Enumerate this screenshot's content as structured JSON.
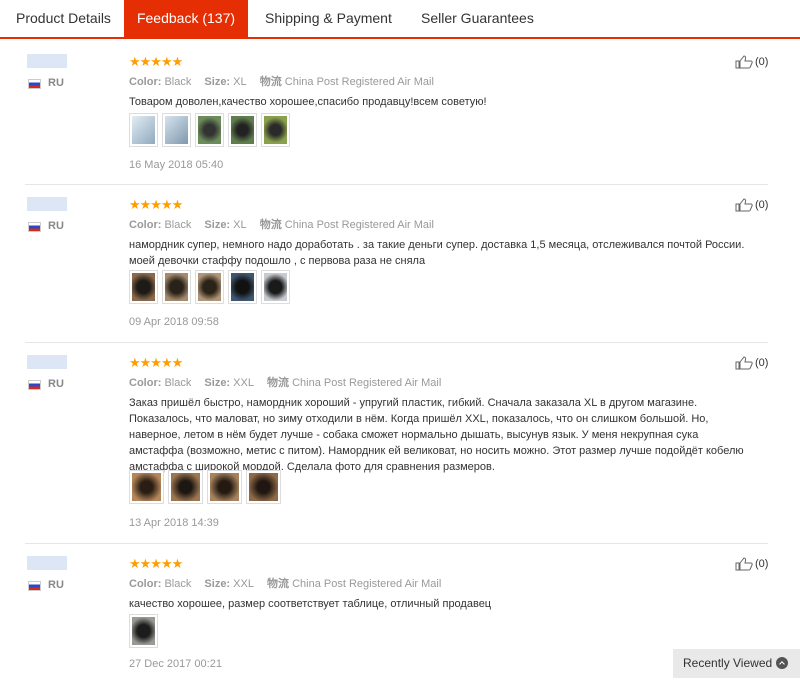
{
  "tabs": [
    "Product Details",
    "Feedback (137)",
    "Shipping & Payment",
    "Seller Guarantees"
  ],
  "labels": {
    "color": "Color:",
    "size": "Size:",
    "shipping": "物流",
    "stars": "★★★★★"
  },
  "reviews": [
    {
      "country": "RU",
      "color": "Black",
      "size": "XL",
      "shipping": "China Post Registered Air Mail",
      "text": "Товаром доволен,качество хорошее,спасибо продавцу!всем советую!",
      "date": "16 May 2018 05:40",
      "likes": "(0)",
      "photo_count": 5,
      "rating": 5
    },
    {
      "country": "RU",
      "color": "Black",
      "size": "XL",
      "shipping": "China Post Registered Air Mail",
      "text": "намордник супер, немного надо доработать . за такие деньги супер. доставка 1,5 месяца, отслеживался почтой России. моей девочки стаффу подошло , с первова раза не сняла",
      "date": "09 Apr 2018 09:58",
      "likes": "(0)",
      "photo_count": 5,
      "rating": 5
    },
    {
      "country": "RU",
      "color": "Black",
      "size": "XXL",
      "shipping": "China Post Registered Air Mail",
      "text": "Заказ пришёл быстро, намордник хороший - упругий пластик, гибкий. Сначала заказала XL в другом магазине. Показалось, что маловат, но зиму отходили в нём. Когда пришёл XXL, показалось, что он слишком большой. Но, наверное, летом в нём будет лучше - собака сможет нормально дышать, высунув язык. У меня некрупная сука амстаффа (возможно, метис с питом). Намордник ей великоват, но носить можно. Этот размер лучше подойдёт кобелю амстаффа с широкой мордой. Сделала фото для сравнения размеров.",
      "date": "13 Apr 2018 14:39",
      "likes": "(0)",
      "photo_count": 4,
      "rating": 5
    },
    {
      "country": "RU",
      "color": "Black",
      "size": "XXL",
      "shipping": "China Post Registered Air Mail",
      "text": "качество хорошее, размер соответствует таблице, отличный продавец",
      "date": "27 Dec 2017 00:21",
      "likes": "(0)",
      "photo_count": 1,
      "rating": 5
    }
  ],
  "recently_viewed": "Recently Viewed",
  "icons": {
    "like": "thumbs-up-icon",
    "flag": "russia-flag-icon",
    "chevron": "chevron-up-icon"
  },
  "colors": {
    "accent": "#e62e04",
    "stars": "#ff9e00"
  }
}
